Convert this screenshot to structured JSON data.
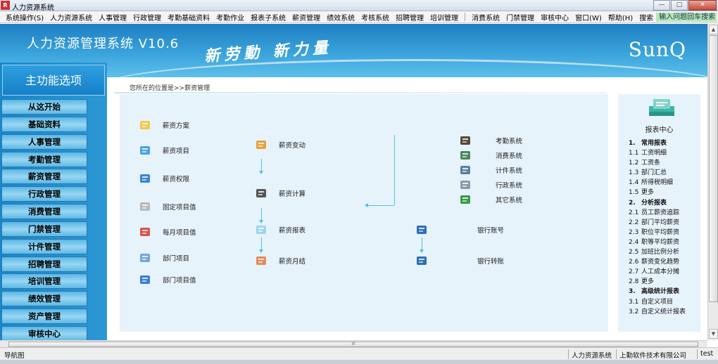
{
  "window": {
    "title": "人力资源系统",
    "controls": [
      "—",
      "▢",
      "✕"
    ]
  },
  "menu": {
    "items": [
      "系统操作(S)",
      "人力资源系统",
      "人事管理",
      "行政管理",
      "考勤基础资料",
      "考勤作业",
      "报表子系统",
      "薪资管理",
      "绩效系统",
      "考核系统",
      "招聘管理",
      "培训管理"
    ],
    "items2": [
      "消费系统",
      "门禁管理",
      "审核中心",
      "窗口(W)",
      "帮助(H)",
      "搜索"
    ],
    "search_placeholder": "输入问题回车搜索"
  },
  "banner": {
    "title": "人力资源管理系统 V10.6",
    "slogan": "新劳動 新力量",
    "logo": "SunQ"
  },
  "sidebar": {
    "title": "主功能选项",
    "items": [
      "从这开始",
      "基础资料",
      "人事管理",
      "考勤管理",
      "薪资管理",
      "行政管理",
      "消费管理",
      "门禁管理",
      "计件管理",
      "招聘管理",
      "培训管理",
      "绩效管理",
      "资产管理",
      "审核中心"
    ]
  },
  "breadcrumb": "您所在的位置是>>薪资管理",
  "flow": {
    "col1": [
      "薪资方案",
      "薪资项目",
      "薪资权限",
      "固定项目值",
      "每月项目值",
      "部门项目",
      "部门项目值"
    ],
    "col2": [
      "薪资变动",
      "薪资计算",
      "薪资报表",
      "薪资月结"
    ],
    "col3": [
      "银行账号",
      "银行转账"
    ],
    "col4": [
      "考勤系统",
      "消费系统",
      "计件系统",
      "行政系统",
      "其它系统"
    ]
  },
  "report": {
    "title": "报表中心",
    "lines": [
      {
        "n": "1.",
        "t": "常用报表",
        "h": true
      },
      {
        "n": "1.1",
        "t": "工资明细",
        "h": false
      },
      {
        "n": "1.2",
        "t": "工资条",
        "h": false
      },
      {
        "n": "1.3",
        "t": "部门汇总",
        "h": false
      },
      {
        "n": "1.4",
        "t": "所得税明细",
        "h": false
      },
      {
        "n": "1.5",
        "t": "更多",
        "h": false
      },
      {
        "n": "2.",
        "t": "分析报表",
        "h": true
      },
      {
        "n": "2.1",
        "t": "员工薪资追踪",
        "h": false
      },
      {
        "n": "2.2",
        "t": "部门平均薪资",
        "h": false
      },
      {
        "n": "2.3",
        "t": "职位平均薪资",
        "h": false
      },
      {
        "n": "2.4",
        "t": "职等平均薪资",
        "h": false
      },
      {
        "n": "2.5",
        "t": "加班比例分析",
        "h": false
      },
      {
        "n": "2.6",
        "t": "薪资变化趋势",
        "h": false
      },
      {
        "n": "2.7",
        "t": "人工成本分摊",
        "h": false
      },
      {
        "n": "2.8",
        "t": "更多",
        "h": false
      },
      {
        "n": "3.",
        "t": "高级统计报表",
        "h": true
      },
      {
        "n": "3.1",
        "t": "自定义项目",
        "h": false
      },
      {
        "n": "3.2",
        "t": "自定义统计报表",
        "h": false
      }
    ]
  },
  "statusbar": {
    "nav": "导航图",
    "system": "人力资源系统",
    "company": "上勤软件技术有限公司",
    "user": "test"
  },
  "scroll": {
    "h_grip": "III"
  },
  "colors": {
    "banner": "#2b8fd0",
    "nav": "#1a87c9",
    "panel": "#e7f3fa",
    "flowline": "#4fc3d9"
  },
  "icons": {
    "col1": [
      "folder-icon",
      "card-icon",
      "user-key-icon",
      "cylinder-icon",
      "calendar-icon",
      "pen-doc-icon",
      "card-list-icon"
    ],
    "col2": [
      "people-icon",
      "calculator-icon",
      "report-icon",
      "stamp-icon"
    ],
    "col3": [
      "bank-icon",
      "transfer-icon"
    ],
    "col4": [
      "attendance-icon",
      "consume-icon",
      "piecework-icon",
      "admin-icon",
      "other-icon"
    ]
  }
}
